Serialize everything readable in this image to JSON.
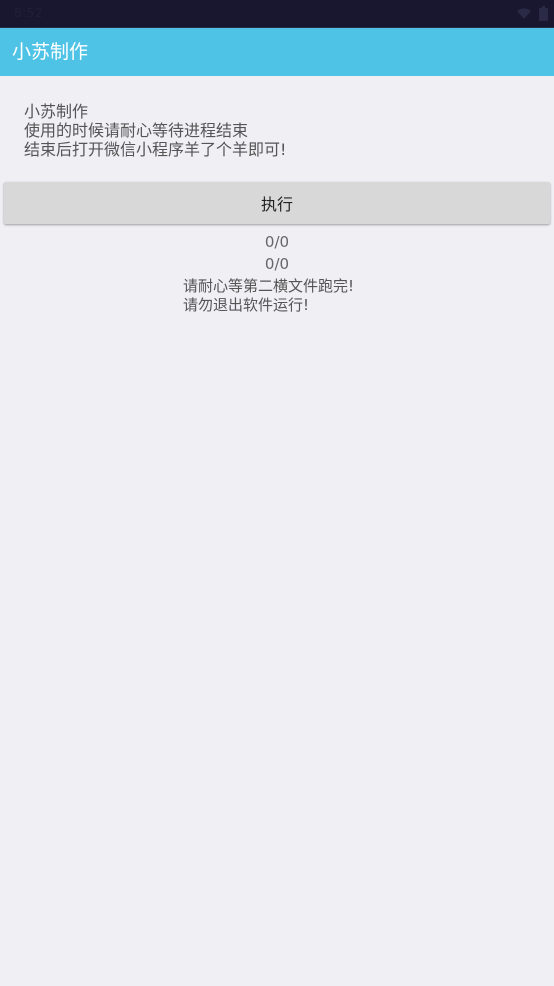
{
  "status_bar": {
    "time": "8:52",
    "wifi_icon": "wifi-icon",
    "battery_icon": "battery-icon"
  },
  "app_bar": {
    "title": "小苏制作"
  },
  "intro": {
    "line1": "小苏制作",
    "line2": "使用的时候请耐心等待进程结束",
    "line3": "结束后打开微信小程序羊了个羊即可!"
  },
  "execute_button": {
    "label": "执行"
  },
  "progress": {
    "counter1": "0/0",
    "counter2": "0/0"
  },
  "notice": {
    "line1": "请耐心等第二横文件跑完!",
    "line2": "请勿退出软件运行!"
  },
  "colors": {
    "app_bar": "#4fc3e6",
    "background": "#efeff4",
    "status_bar": "#18172f",
    "button": "#d8d8d8"
  }
}
